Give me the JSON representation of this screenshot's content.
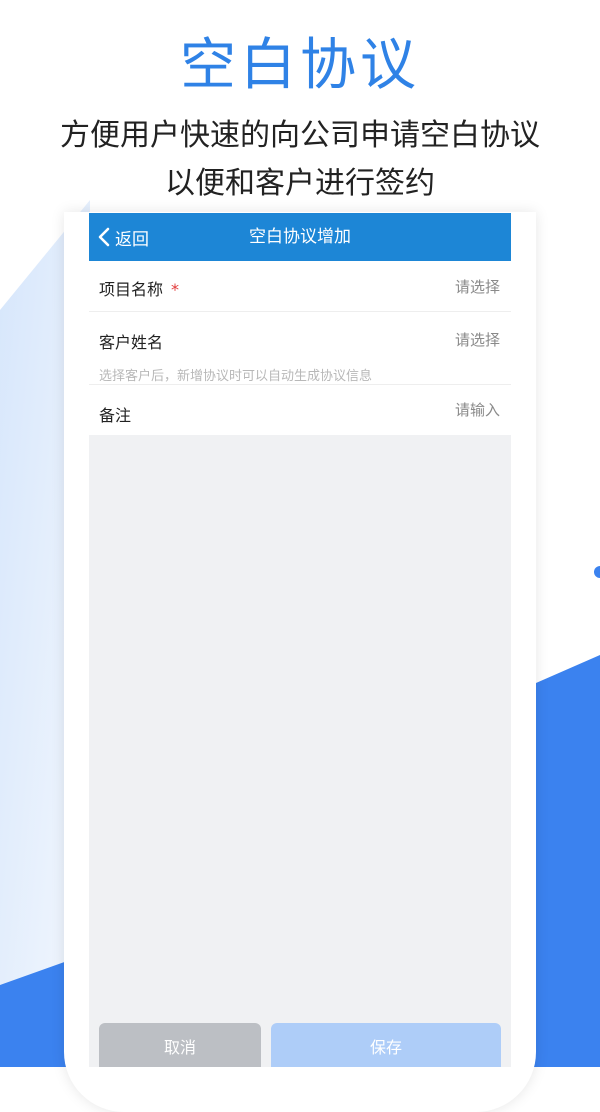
{
  "promo": {
    "title": "空白协议",
    "subtitle_line1": "方便用户快速的向公司申请空白协议",
    "subtitle_line2": "以便和客户进行签约"
  },
  "navbar": {
    "back_label": "返回",
    "title": "空白协议增加"
  },
  "form": {
    "project": {
      "label": "项目名称",
      "required_mark": "*",
      "value": "请选择"
    },
    "customer": {
      "label": "客户姓名",
      "value": "请选择",
      "hint": "选择客户后，新增协议时可以自动生成协议信息"
    },
    "remark": {
      "label": "备注",
      "value": "请输入"
    }
  },
  "buttons": {
    "cancel": "取消",
    "save": "保存"
  },
  "colors": {
    "brand_blue": "#2f82e6",
    "navbar_blue": "#1d86d6",
    "required_red": "#e23a3a",
    "cancel_gray": "#bcbfc4",
    "save_light_blue": "#aecdf8"
  }
}
